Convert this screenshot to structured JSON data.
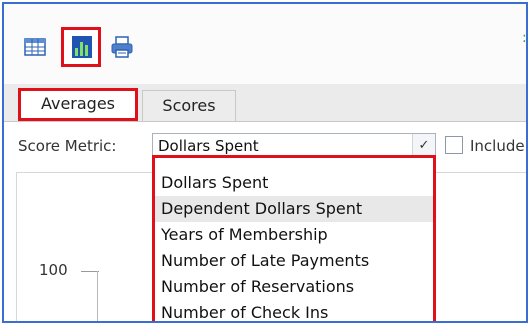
{
  "toolbar": {
    "icons": [
      "grid-icon",
      "bar-chart-icon",
      "printer-icon"
    ]
  },
  "tabs": [
    {
      "label": "Averages",
      "active": true
    },
    {
      "label": "Scores",
      "active": false
    }
  ],
  "score_metric": {
    "label": "Score Metric:",
    "selected_value": "Dollars Spent",
    "include_label": "Include"
  },
  "dropdown": {
    "options": [
      "Dollars Spent",
      "Dependent Dollars Spent",
      "Years of Membership",
      "Number of Late Payments",
      "Number of Reservations",
      "Number of Check Ins"
    ],
    "hovered": "Dependent Dollars Spent"
  },
  "chart": {
    "y_tick": "100"
  },
  "colors": {
    "highlight_border": "#e0101a",
    "frame_border": "#3a6fd1"
  }
}
